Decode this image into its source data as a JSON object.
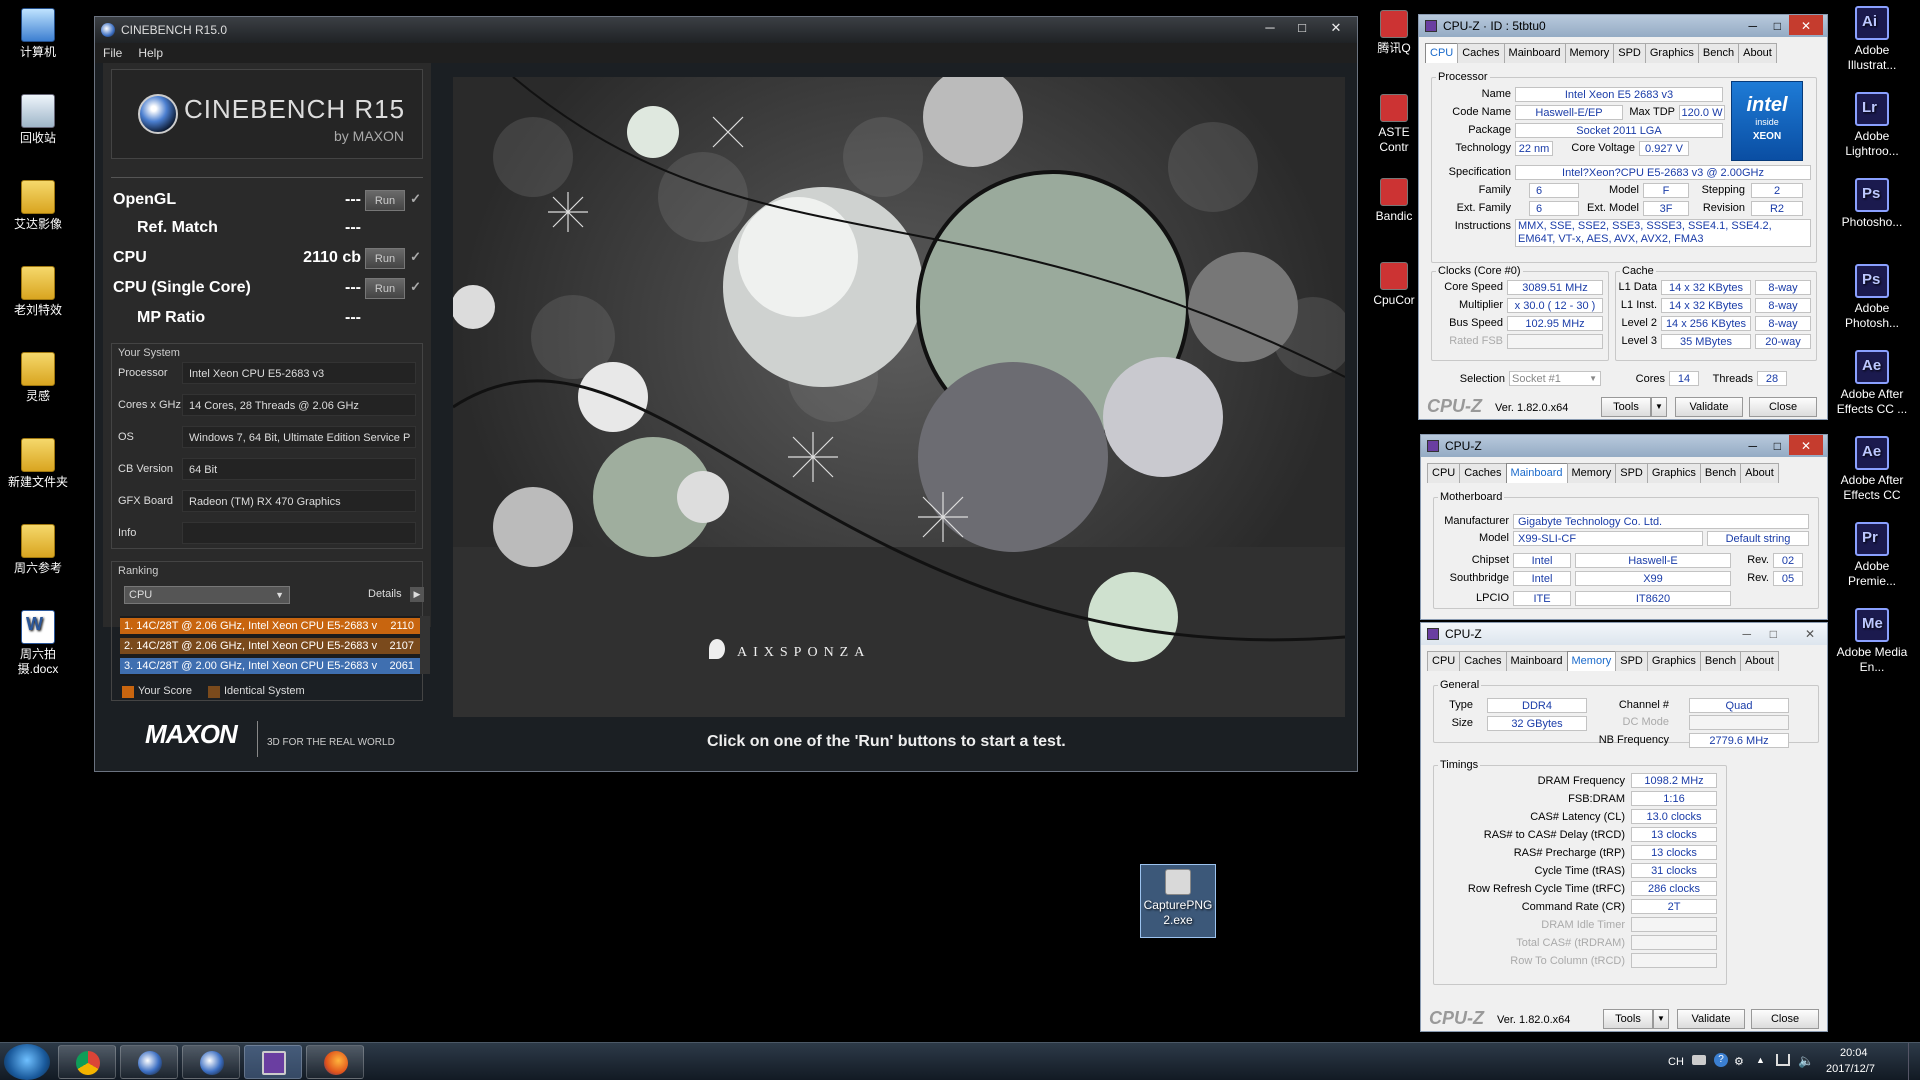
{
  "desktop_left": [
    {
      "label": "计算机",
      "icon": "computer-icon",
      "cls": "computer"
    },
    {
      "label": "回收站",
      "icon": "recycle-bin-icon",
      "cls": "recycle"
    },
    {
      "label": "艾达影像",
      "icon": "folder-icon",
      "cls": "folder"
    },
    {
      "label": "老刘特效",
      "icon": "folder-icon",
      "cls": "folder"
    },
    {
      "label": "灵感",
      "icon": "folder-icon",
      "cls": "folder"
    },
    {
      "label": "新建文件夹",
      "icon": "folder-icon",
      "cls": "folder"
    },
    {
      "label": "周六参考",
      "icon": "folder-icon",
      "cls": "folder"
    },
    {
      "label": "周六拍摄.docx",
      "icon": "word-document-icon",
      "cls": "docx"
    }
  ],
  "desktop_mid": [
    {
      "label": "腾讯Q",
      "icon": "app-icon"
    },
    {
      "label": "ASTE Contr",
      "icon": "app-icon"
    },
    {
      "label": "Bandic",
      "icon": "app-icon"
    },
    {
      "label": "CpuCor",
      "icon": "app-icon"
    }
  ],
  "desktop_right": [
    {
      "label": "Adobe Illustrat...",
      "g": "Ai"
    },
    {
      "label": "Adobe Lightroo...",
      "g": "Lr"
    },
    {
      "label": "Photosho...",
      "g": "Ps"
    },
    {
      "label": "Adobe Photosh...",
      "g": "Ps"
    },
    {
      "label": "Adobe After Effects CC ...",
      "g": "Ae"
    },
    {
      "label": "Adobe After Effects CC",
      "g": "Ae"
    },
    {
      "label": "Adobe Premie...",
      "g": "Pr"
    },
    {
      "label": "Adobe Media En...",
      "g": "Me"
    }
  ],
  "capture_icon": {
    "label": "CapturePNG2.exe"
  },
  "cinebench": {
    "title": "CINEBENCH R15.0",
    "menu": [
      "File",
      "Help"
    ],
    "logo_title": "CINEBENCH R15",
    "logo_sub": "by MAXON",
    "tests": [
      {
        "name": "OpenGL",
        "value": "---",
        "run": "Run",
        "check": "✓"
      },
      {
        "name": "Ref. Match",
        "value": "---"
      },
      {
        "name": "CPU",
        "value": "2110 cb",
        "run": "Run",
        "check": "✓"
      },
      {
        "name": "CPU (Single Core)",
        "value": "---",
        "run": "Run",
        "check": "✓"
      },
      {
        "name": "MP Ratio",
        "value": "---"
      }
    ],
    "your_system_label": "Your System",
    "system": [
      {
        "k": "Processor",
        "v": "Intel Xeon CPU E5-2683 v3"
      },
      {
        "k": "Cores x GHz",
        "v": "14 Cores, 28 Threads @ 2.06 GHz"
      },
      {
        "k": "OS",
        "v": "Windows 7, 64 Bit, Ultimate Edition Service P"
      },
      {
        "k": "CB Version",
        "v": "64 Bit"
      },
      {
        "k": "GFX Board",
        "v": "Radeon (TM) RX 470 Graphics"
      },
      {
        "k": "Info",
        "v": ""
      }
    ],
    "ranking_label": "Ranking",
    "ranking_select": "CPU",
    "details": "Details",
    "ranks": [
      {
        "t": "1. 14C/28T @ 2.06 GHz, Intel Xeon CPU E5-2683 v",
        "s": "2110",
        "c": "#c8650f"
      },
      {
        "t": "2. 14C/28T @ 2.06 GHz, Intel Xeon CPU E5-2683 v",
        "s": "2107",
        "c": "#7a4a1c"
      },
      {
        "t": "3. 14C/28T @ 2.00 GHz, Intel Xeon CPU E5-2683 v",
        "s": "2061",
        "c": "#3f6fb0"
      }
    ],
    "legend_your": "Your Score",
    "legend_ident": "Identical System",
    "maxon": "MAXON",
    "tagline": "3D FOR THE REAL WORLD",
    "brand": "AIXSPONZA",
    "hint": "Click on one of the 'Run' buttons to start a test."
  },
  "cpuz_tabs": [
    "CPU",
    "Caches",
    "Mainboard",
    "Memory",
    "SPD",
    "Graphics",
    "Bench",
    "About"
  ],
  "cpuz1": {
    "title": "CPU-Z · ID : 5tbtu0",
    "processor_label": "Processor",
    "name_k": "Name",
    "name": "Intel Xeon E5 2683 v3",
    "codename_k": "Code Name",
    "codename": "Haswell-E/EP",
    "maxtdp_k": "Max TDP",
    "maxtdp": "120.0 W",
    "package_k": "Package",
    "package": "Socket 2011 LGA",
    "tech_k": "Technology",
    "tech": "22 nm",
    "cv_k": "Core Voltage",
    "cv": "0.927 V",
    "spec_k": "Specification",
    "spec": "Intel?Xeon?CPU E5-2683 v3 @ 2.00GHz",
    "family_k": "Family",
    "family": "6",
    "model_k": "Model",
    "model": "F",
    "stepping_k": "Stepping",
    "stepping": "2",
    "extfam_k": "Ext. Family",
    "extfam": "6",
    "extmod_k": "Ext. Model",
    "extmod": "3F",
    "rev_k": "Revision",
    "rev": "R2",
    "instr_k": "Instructions",
    "instr": "MMX, SSE, SSE2, SSE3, SSSE3, SSE4.1, SSE4.2, EM64T, VT-x, AES, AVX, AVX2, FMA3",
    "clocks_label": "Clocks (Core #0)",
    "cs_k": "Core Speed",
    "cs": "3089.51 MHz",
    "mult_k": "Multiplier",
    "mult": "x 30.0 ( 12 - 30 )",
    "bus_k": "Bus Speed",
    "bus": "102.95 MHz",
    "fsb_k": "Rated FSB",
    "fsb": "",
    "cache_label": "Cache",
    "l1d_k": "L1 Data",
    "l1d": "14 x 32 KBytes",
    "l1d_w": "8-way",
    "l1i_k": "L1 Inst.",
    "l1i": "14 x 32 KBytes",
    "l1i_w": "8-way",
    "l2_k": "Level 2",
    "l2": "14 x 256 KBytes",
    "l2_w": "8-way",
    "l3_k": "Level 3",
    "l3": "35 MBytes",
    "l3_w": "20-way",
    "sel_k": "Selection",
    "sel": "Socket #1",
    "cores_k": "Cores",
    "cores": "14",
    "threads_k": "Threads",
    "threads": "28",
    "intel1": "intel",
    "intel2": "inside",
    "intel3": "XEON"
  },
  "cpuz2": {
    "title": "CPU-Z",
    "mb_label": "Motherboard",
    "man_k": "Manufacturer",
    "man": "Gigabyte Technology Co. Ltd.",
    "model_k": "Model",
    "model": "X99-SLI-CF",
    "model2": "Default string",
    "chip_k": "Chipset",
    "chip1": "Intel",
    "chip2": "Haswell-E",
    "chip_rev_k": "Rev.",
    "chip_rev": "02",
    "sb_k": "Southbridge",
    "sb1": "Intel",
    "sb2": "X99",
    "sb_rev_k": "Rev.",
    "sb_rev": "05",
    "lpcio_k": "LPCIO",
    "lpcio1": "ITE",
    "lpcio2": "IT8620"
  },
  "cpuz3": {
    "title": "CPU-Z",
    "general_label": "General",
    "type_k": "Type",
    "type": "DDR4",
    "size_k": "Size",
    "size": "32 GBytes",
    "chan_k": "Channel #",
    "chan": "Quad",
    "dc_k": "DC Mode",
    "dc": "",
    "nb_k": "NB Frequency",
    "nb": "2779.6 MHz",
    "timings_label": "Timings",
    "timings": [
      {
        "k": "DRAM Frequency",
        "v": "1098.2 MHz"
      },
      {
        "k": "FSB:DRAM",
        "v": "1:16"
      },
      {
        "k": "CAS# Latency (CL)",
        "v": "13.0 clocks"
      },
      {
        "k": "RAS# to CAS# Delay (tRCD)",
        "v": "13 clocks"
      },
      {
        "k": "RAS# Precharge (tRP)",
        "v": "13 clocks"
      },
      {
        "k": "Cycle Time (tRAS)",
        "v": "31 clocks"
      },
      {
        "k": "Row Refresh Cycle Time (tRFC)",
        "v": "286 clocks"
      },
      {
        "k": "Command Rate (CR)",
        "v": "2T"
      },
      {
        "k": "DRAM Idle Timer",
        "v": ""
      },
      {
        "k": "Total CAS# (tRDRAM)",
        "v": ""
      },
      {
        "k": "Row To Column (tRCD)",
        "v": ""
      }
    ]
  },
  "cpuz_footer": {
    "logo": "CPU-Z",
    "version": "Ver. 1.82.0.x64",
    "tools": "Tools",
    "validate": "Validate",
    "close": "Close"
  },
  "tray": {
    "lang": "CH",
    "time": "20:04",
    "date": "2017/12/7"
  }
}
